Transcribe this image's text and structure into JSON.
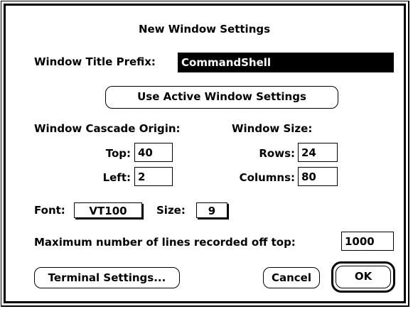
{
  "dialog": {
    "title": "New Window Settings",
    "title_prefix_label": "Window Title Prefix:",
    "title_prefix_value": "CommandShell",
    "use_active_button": "Use Active Window Settings",
    "cascade_heading": "Window Cascade Origin:",
    "size_heading": "Window Size:",
    "top_label": "Top:",
    "top_value": "40",
    "left_label": "Left:",
    "left_value": "2",
    "rows_label": "Rows:",
    "rows_value": "24",
    "columns_label": "Columns:",
    "columns_value": "80",
    "font_label": "Font:",
    "font_value": "VT100",
    "size_label": "Size:",
    "size_value": "9",
    "max_lines_label": "Maximum number of lines recorded off top:",
    "max_lines_value": "1000",
    "terminal_button": "Terminal Settings...",
    "cancel_button": "Cancel",
    "ok_button": "OK"
  }
}
